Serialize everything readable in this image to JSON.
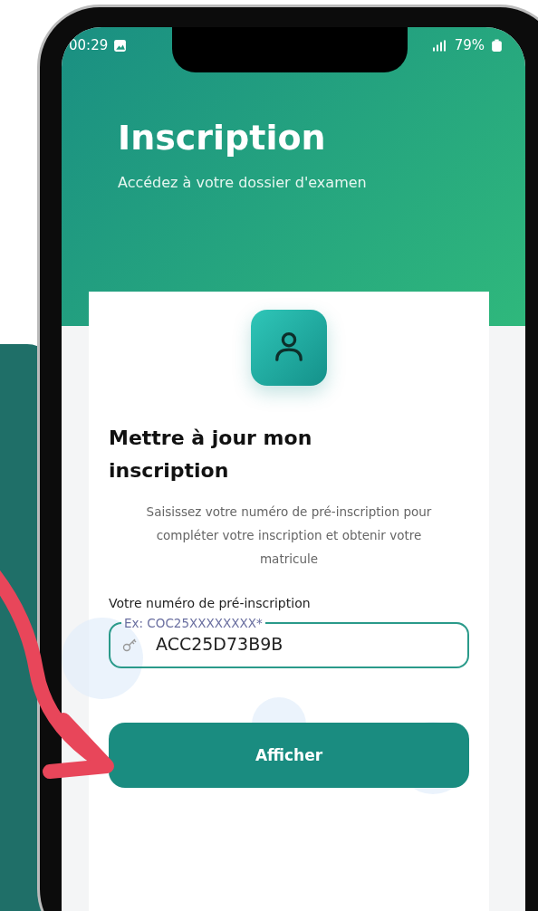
{
  "status_bar": {
    "time": "00:29",
    "battery": "79%"
  },
  "header": {
    "title": "Inscription",
    "subtitle": "Accédez à votre dossier d'examen"
  },
  "card": {
    "title": "Mettre à jour mon inscription",
    "description": "Saisissez votre numéro de pré-inscription pour compléter votre inscription et obtenir votre matricule",
    "field": {
      "label": "Votre numéro de pré-inscription",
      "floating_label": "Ex: COC25XXXXXXXX*",
      "value": "ACC25D73B9B"
    },
    "button": "Afficher"
  }
}
